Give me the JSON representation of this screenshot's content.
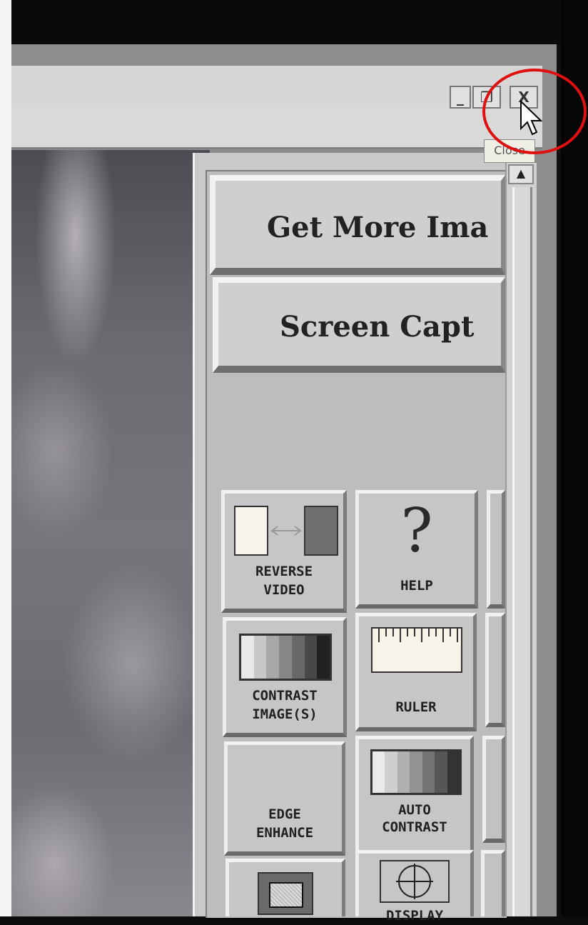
{
  "window": {
    "controls": {
      "minimize": "_",
      "restore": "❐",
      "close": "X"
    },
    "tooltip": "Close"
  },
  "panel": {
    "buttons": {
      "get_more": "Get More Ima",
      "screen_capture": "Screen Capt"
    },
    "tools": {
      "reverse_video": {
        "line1": "REVERSE",
        "line2": "VIDEO"
      },
      "help": {
        "label": "HELP",
        "glyph": "?"
      },
      "contrast_images": {
        "line1": "CONTRAST",
        "line2": "IMAGE(S)"
      },
      "ruler": {
        "label": "RULER"
      },
      "edge_enhance": {
        "line1": "EDGE",
        "line2": "ENHANCE"
      },
      "auto_contrast": {
        "line1": "AUTO",
        "line2": "CONTRAST"
      },
      "display": {
        "label": "DISPLAY"
      }
    }
  },
  "scrollbar": {
    "up_arrow": "▲"
  },
  "icons": [
    "minimize-icon",
    "restore-icon",
    "close-icon",
    "reverse-video-icon",
    "help-icon",
    "contrast-icon",
    "ruler-icon",
    "auto-contrast-icon",
    "display-crosshair-icon",
    "pointer-cursor-icon"
  ],
  "colors": {
    "annotation_circle": "#e01010",
    "panel_gray": "#c6c6c6"
  }
}
